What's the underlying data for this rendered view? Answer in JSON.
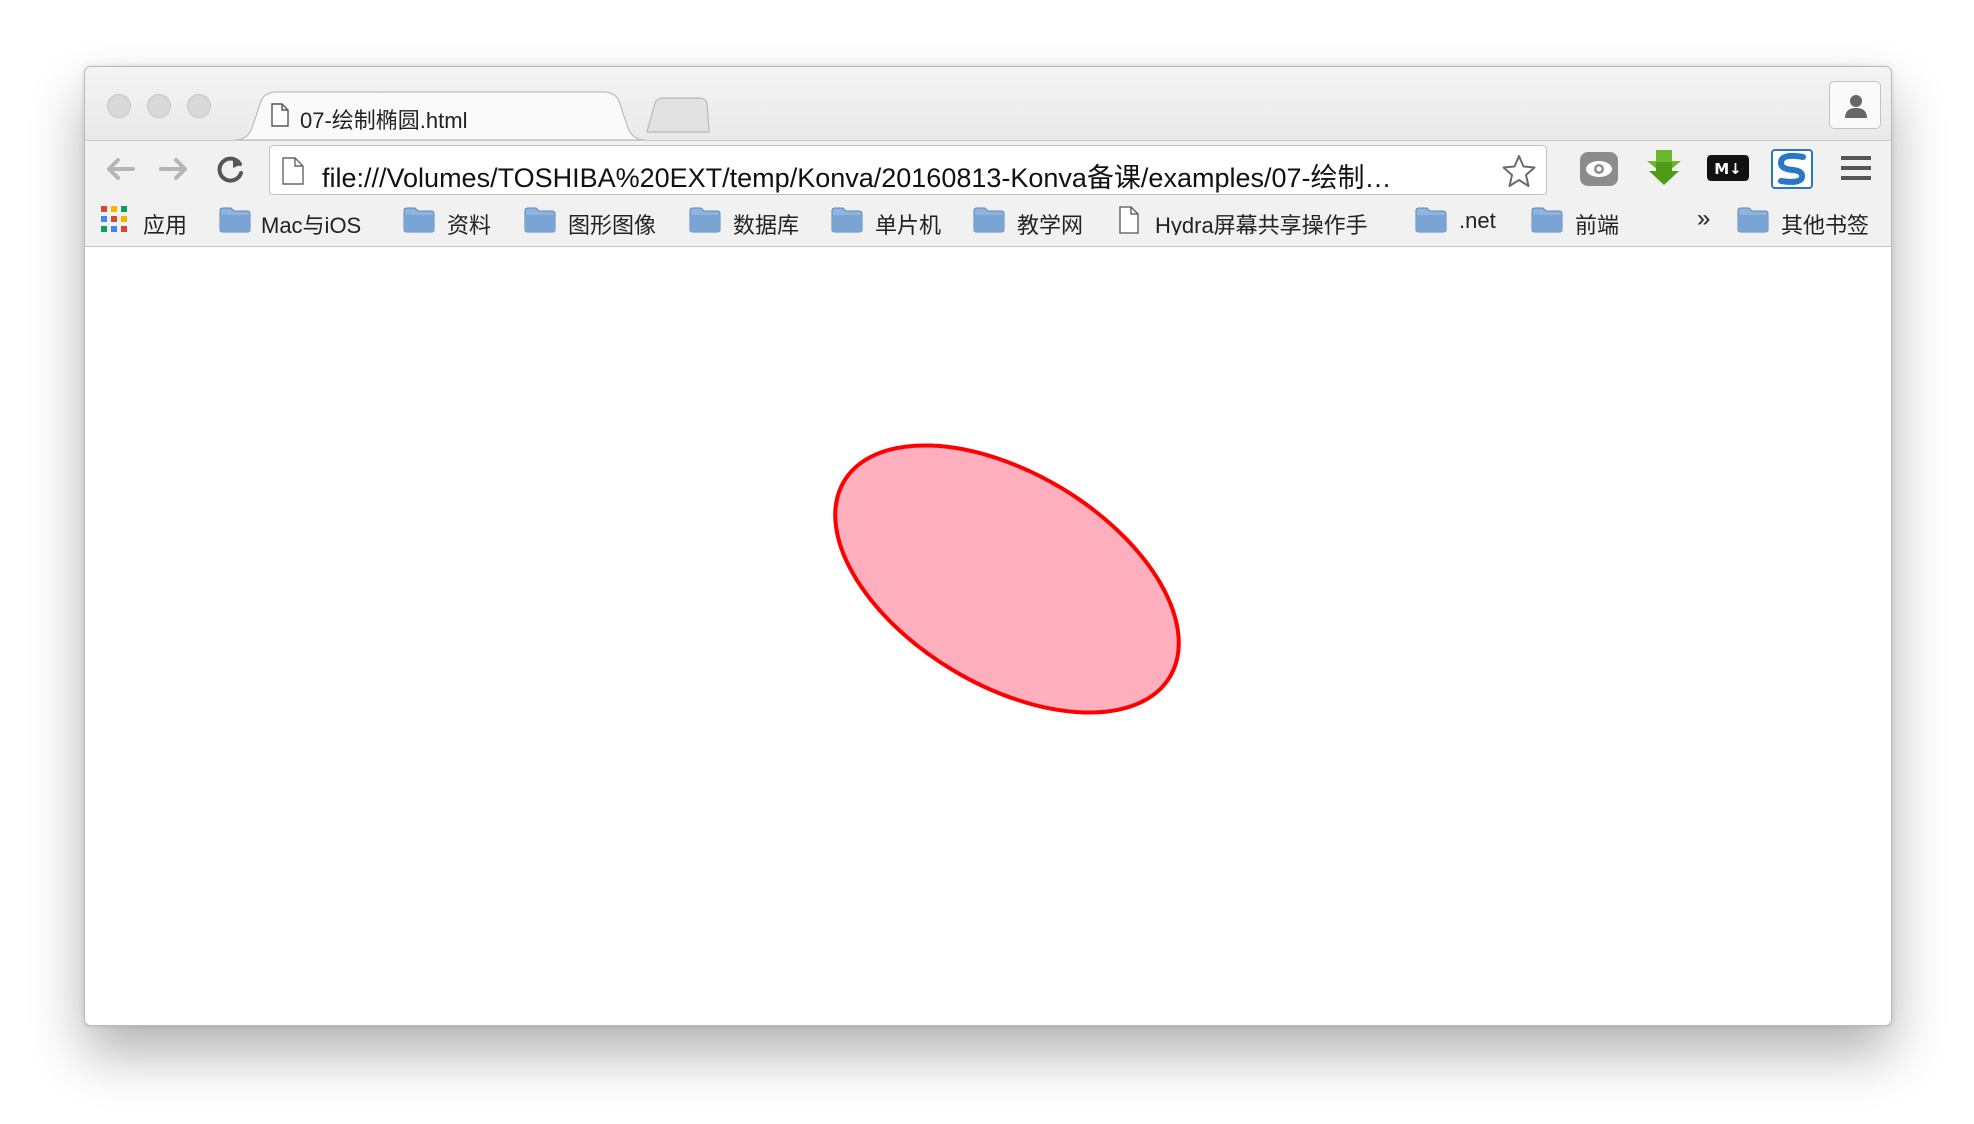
{
  "tab": {
    "title": "07-绘制椭圆.html"
  },
  "omnibox": {
    "url": "file:///Volumes/TOSHIBA%20EXT/temp/Konva/20160813-Konva备课/examples/07-绘制…"
  },
  "bookmarks": {
    "apps_label": "应用",
    "items": [
      "Mac与iOS",
      "资料",
      "图形图像",
      "数据库",
      "单片机",
      "教学网"
    ],
    "page_item": "Hydra屏幕共享操作手",
    "items2": [
      ".net",
      "前端"
    ],
    "overflow": "»",
    "other": "其他书签"
  },
  "extensions": {
    "markdown_label": "M↓"
  },
  "canvas": {
    "ellipse_fill": "#ffafbd",
    "ellipse_stroke": "#ff0000"
  }
}
